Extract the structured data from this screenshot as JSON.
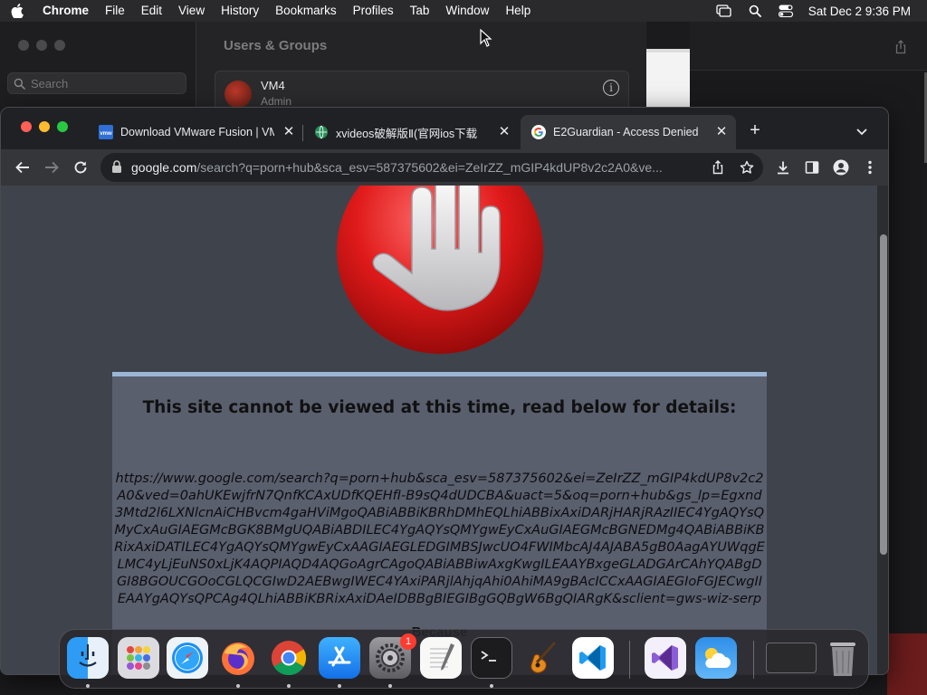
{
  "menubar": {
    "app_name": "Chrome",
    "items": [
      "File",
      "Edit",
      "View",
      "History",
      "Bookmarks",
      "Profiles",
      "Tab",
      "Window",
      "Help"
    ],
    "clock": "Sat Dec 2  9:36 PM"
  },
  "background": {
    "search_placeholder": "Search",
    "users_groups_title": "Users & Groups",
    "user_name": "VM4",
    "user_role": "Admin"
  },
  "browser": {
    "tabs": [
      {
        "title": "Download VMware Fusion | VM",
        "icon": "vmware-favicon",
        "active": false
      },
      {
        "title": "xvideos破解版Ⅱ(官网ios下载",
        "icon": "globe-favicon",
        "active": false
      },
      {
        "title": "E2Guardian - Access Denied",
        "icon": "google-favicon",
        "active": true
      }
    ],
    "url_host": "google.com",
    "url_rest": "/search?q=porn+hub&sca_esv=587375602&ei=ZeIrZZ_mGIP4kdUP8v2c2A0&ve..."
  },
  "page": {
    "heading": "This site cannot be viewed at this time, read below for details:",
    "blocked_url": "https://www.google.com/search?q=porn+hub&sca_esv=587375602&ei=ZeIrZZ_mGIP4kdUP8v2c2A0&ved=0ahUKEwjfrN7QnfKCAxUDfKQEHfI-B9sQ4dUDCBA&uact=5&oq=porn+hub&gs_lp=Egxnd3Mtd2l6LXNlcnAiCHBvcm4gaHViMgoQABiABBiKBRhDMhEQLhiABBixAxiDARjHARjRAzIIEC4YgAQYsQMyCxAuGIAEGMcBGK8BMgUQABiABDILEC4YgAQYsQMYgwEyCxAuGIAEGMcBGNEDMg4QABiABBiKBRixAxiDATILEC4YgAQYsQMYgwEyCxAAGIAEGLEDGIMBSJwcUO4FWIMbcAJ4AJABA5gB0AagAYUWqgELMC4yLjEuNS0xLjK4AQPIAQD4AQGoAgrCAgoQABiABBiwAxgKwgILEAAYBxgeGLADGArCAhYQABgDGI8BGOUCGOoCGLQCGIwD2AEBwgIWEC4YAxiPARjlAhjqAhi0AhiMA9gBAcICCxAAGIAEGIoFGJECwgIIEAAYgAQYsQPCAg4QLhiABBiKBRixAxiDAeIDBBgBIEGIBgGQBgW6BgQIARgK&sclient=gws-wiz-serp",
    "because": "Because"
  },
  "dock": {
    "apps": [
      "Finder",
      "Launchpad",
      "Safari",
      "Firefox",
      "Chrome",
      "App Store",
      "System Settings",
      "TextEdit",
      "Terminal",
      "Instruments",
      "Visual Studio Code",
      "Visual Studio",
      "Weather"
    ],
    "settings_badge": "1"
  },
  "colors": {
    "menubar": "#2a2a2c",
    "tabstrip": "#202124",
    "toolbar": "#35363a",
    "page_bg": "#3f434c",
    "card_bg": "#5a5f6e",
    "card_border": "#9bb6d6"
  }
}
